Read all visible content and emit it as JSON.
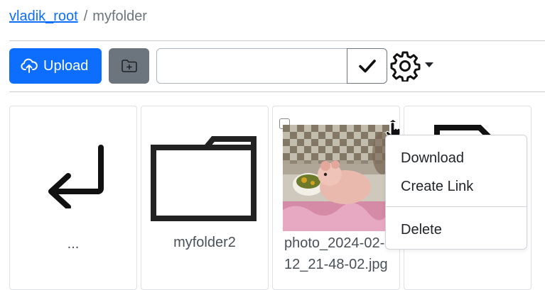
{
  "breadcrumb": {
    "root": "vladik_root",
    "separator": "/",
    "current": "myfolder"
  },
  "toolbar": {
    "upload_label": "Upload",
    "name_input_value": "",
    "icons": {
      "upload": "cloud-upload-icon",
      "new_folder": "folder-plus-icon",
      "confirm": "checkmark-icon",
      "settings": "gear-icon",
      "dropdown": "caret-down-icon"
    }
  },
  "items": [
    {
      "name": "...",
      "icon": "return-arrow-icon"
    },
    {
      "name": "myfolder2",
      "icon": "folder-icon"
    },
    {
      "name": "photo_2024-02-12_21-48-02.jpg",
      "name_line1": "photo_2024-02-",
      "name_line2": "12_21-48-02.jpg",
      "icon": "image-thumbnail"
    },
    {
      "name": "",
      "icon": "file-icon"
    }
  ],
  "context_menu": {
    "items": [
      "Download",
      "Create Link",
      "Delete"
    ]
  },
  "colors": {
    "primary": "#0d6efd",
    "secondary": "#6c757d",
    "text": "#212529",
    "muted": "#6c757d"
  }
}
